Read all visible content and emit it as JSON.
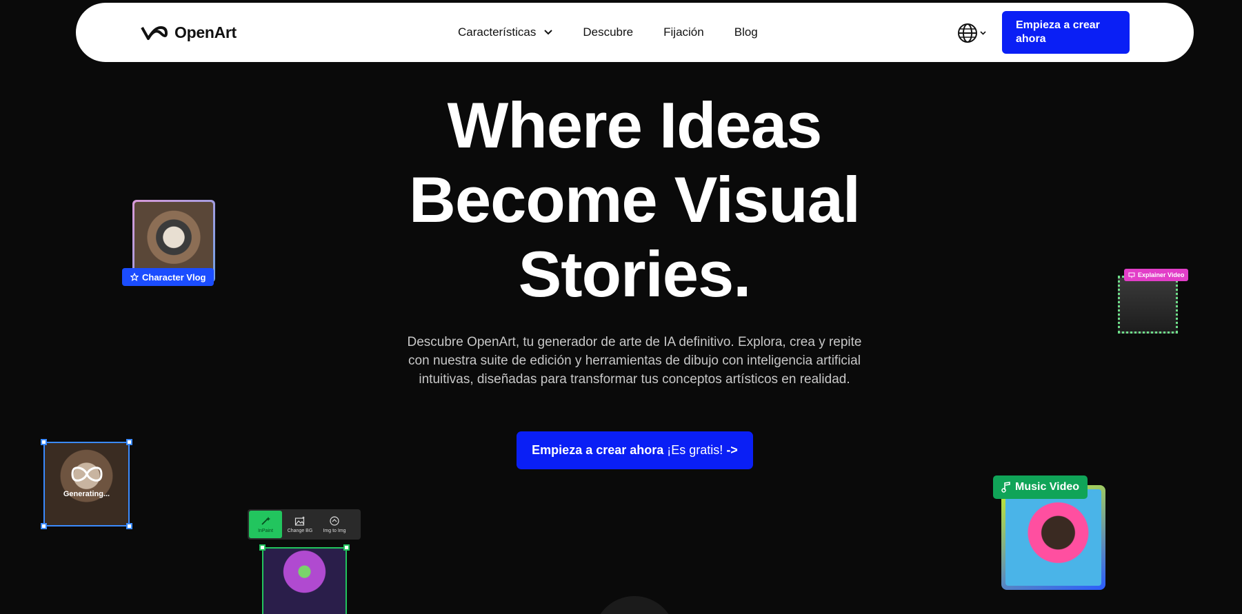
{
  "nav": {
    "logo_text": "OpenArt",
    "items": [
      {
        "label": "Características"
      },
      {
        "label": "Descubre"
      },
      {
        "label": "Fijación"
      },
      {
        "label": "Blog"
      }
    ],
    "cta_label": "Empieza a crear ahora"
  },
  "hero": {
    "title_line1": "Where Ideas",
    "title_line2": "Become Visual",
    "title_line3": "Stories.",
    "subtitle": "Descubre OpenArt, tu generador de arte de IA definitivo. Explora, crea y repite con nuestra suite de edición y herramientas de dibujo con inteligencia artificial intuitivas, diseñadas para transformar tus conceptos artísticos en realidad.",
    "cta_strong": "Empieza a crear ahora",
    "cta_light": "¡Es gratis!",
    "cta_arrow": "->"
  },
  "cards": {
    "character_vlog": "Character Vlog",
    "explainer_video": "Explainer Video",
    "generating": "Generating...",
    "music_video": "Music Video",
    "tools": [
      {
        "label": "InPaint"
      },
      {
        "label": "Change BG"
      },
      {
        "label": "Img to Img"
      }
    ]
  },
  "colors": {
    "accent": "#0a1ff5",
    "background": "#0a0a0a",
    "navbar": "#ffffff"
  }
}
